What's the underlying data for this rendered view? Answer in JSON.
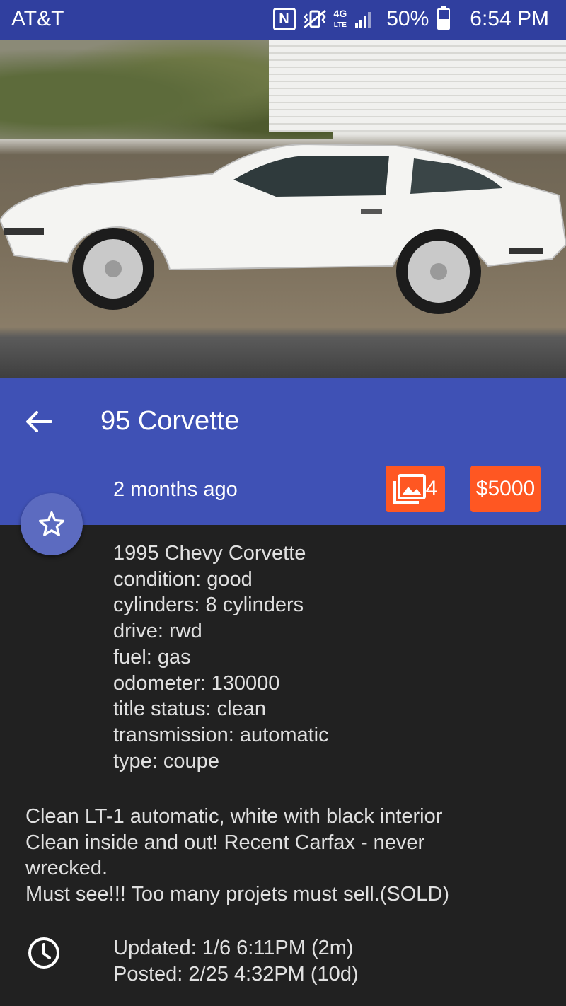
{
  "status_bar": {
    "carrier": "AT&T",
    "battery": "50%",
    "battery_level": 0.5,
    "time": "6:54 PM",
    "icons": [
      "nfc-icon",
      "vibrate-icon",
      "lte-icon",
      "signal-icon",
      "battery-icon"
    ]
  },
  "appbar": {
    "title": "95 Corvette",
    "age": "2 months ago",
    "photo_count": "4",
    "price": "$5000",
    "accent": "#3f51b5",
    "badge_color": "#ff5722"
  },
  "details": {
    "lines": [
      "1995 Chevy Corvette",
      "condition: good",
      "cylinders: 8 cylinders",
      "drive: rwd",
      "fuel: gas",
      "odometer: 130000",
      "title status: clean",
      "transmission: automatic",
      "type: coupe"
    ]
  },
  "description": {
    "lines": [
      "Clean LT-1 automatic, white with black interior",
      "Clean inside and out! Recent Carfax - never",
      "wrecked.",
      "Must see!!! Too many projets must sell.(SOLD)"
    ]
  },
  "times": {
    "updated": "Updated: 1/6 6:11PM (2m)",
    "posted": "Posted: 2/25 4:32PM (10d)"
  }
}
